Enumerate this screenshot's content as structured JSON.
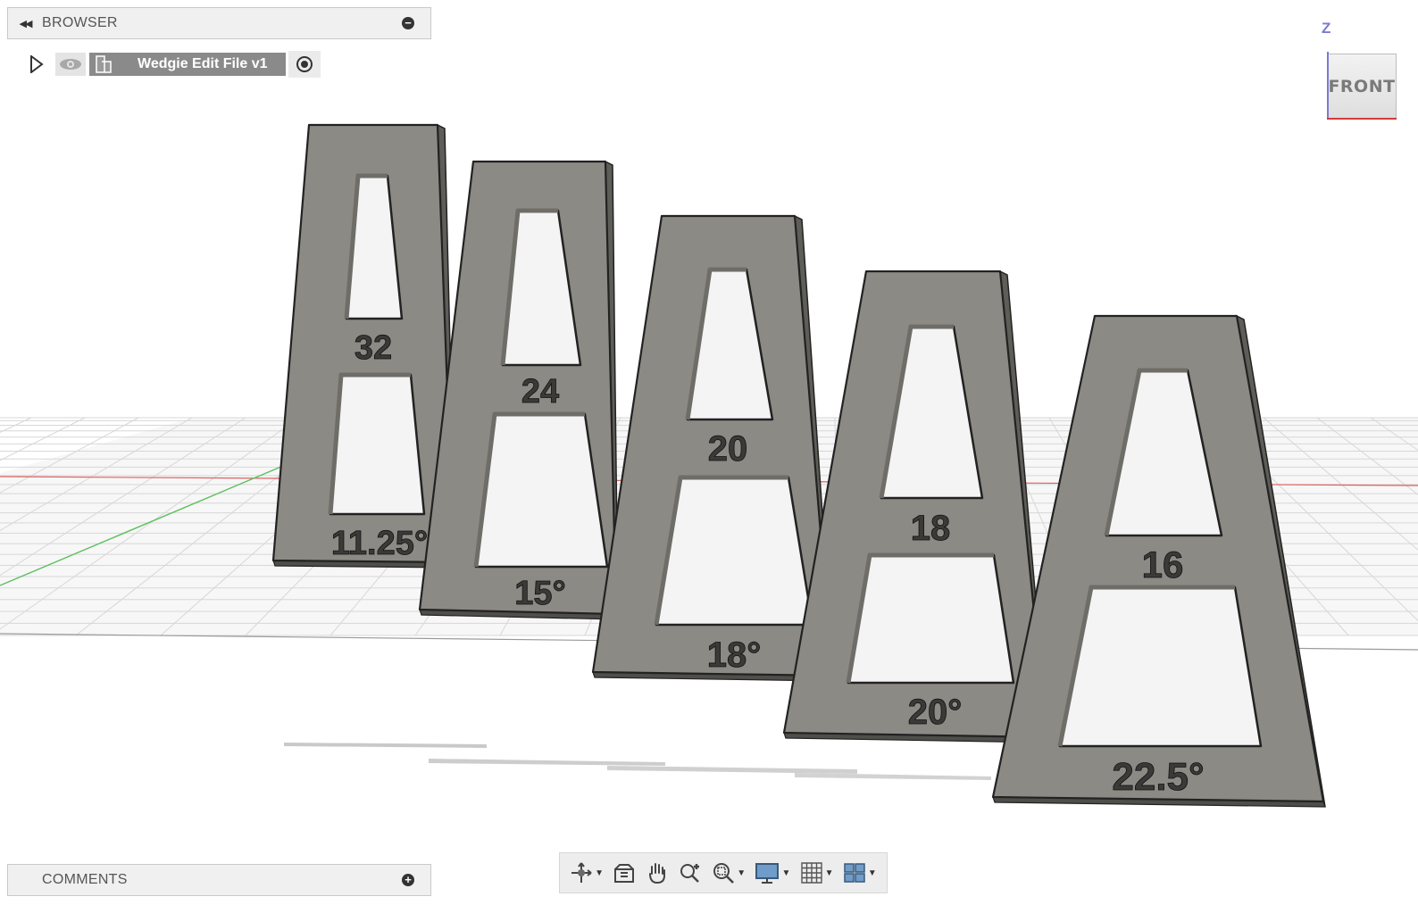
{
  "browser": {
    "title": "BROWSER"
  },
  "tree": {
    "document_name": "Wedgie Edit File v1"
  },
  "comments": {
    "title": "COMMENTS"
  },
  "viewcube": {
    "axis_label": "Z",
    "face_label": "FRONT"
  },
  "wedges": [
    {
      "count": "32",
      "angle": "11.25°"
    },
    {
      "count": "24",
      "angle": "15°"
    },
    {
      "count": "20",
      "angle": "18°"
    },
    {
      "count": "18",
      "angle": "20°"
    },
    {
      "count": "16",
      "angle": "22.5°"
    }
  ],
  "toolbar": {
    "tools": [
      "orbit-icon",
      "look-at-icon",
      "pan-icon",
      "zoom-icon",
      "fit-icon",
      "display-settings-icon",
      "grid-icon",
      "viewports-icon"
    ]
  },
  "colors": {
    "part": "#8c8a84",
    "part_edge": "#222222",
    "grid": "#d7d7d7",
    "x_axis": "#e06060",
    "y_axis": "#5dbf5d"
  }
}
